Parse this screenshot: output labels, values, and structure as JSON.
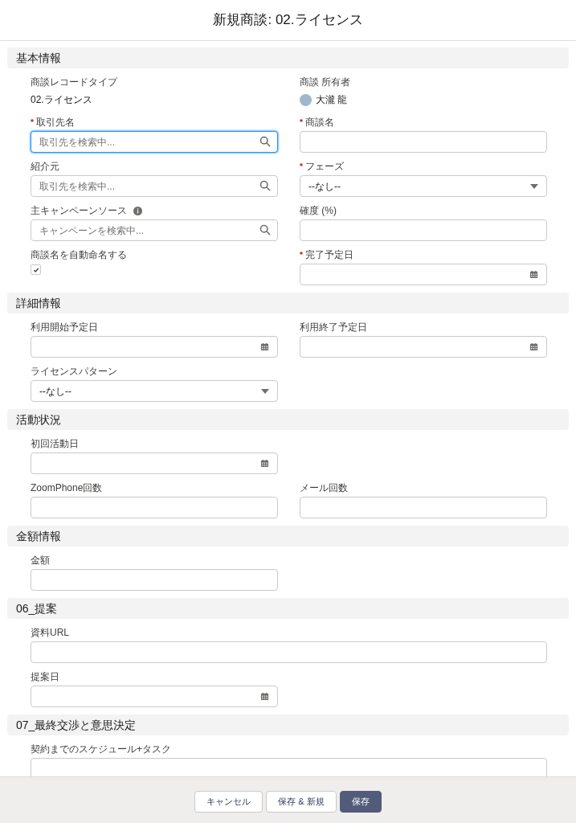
{
  "modal": {
    "title": "新規商談: 02.ライセンス"
  },
  "sections": [
    {
      "title": "基本情報",
      "rows": [
        [
          {
            "kind": "static",
            "label": "商談レコードタイプ",
            "value": "02.ライセンス",
            "required": false
          },
          {
            "kind": "owner",
            "label": "商談 所有者",
            "value": "大瀧 龍",
            "required": false
          }
        ],
        [
          {
            "kind": "lookup",
            "label": "取引先名",
            "placeholder": "取引先を検索中...",
            "required": true,
            "focused": true
          },
          {
            "kind": "text",
            "label": "商談名",
            "required": true
          }
        ],
        [
          {
            "kind": "lookup",
            "label": "紹介元",
            "placeholder": "取引先を検索中...",
            "required": false,
            "focused": false
          },
          {
            "kind": "picklist",
            "label": "フェーズ",
            "value": "--なし--",
            "required": true
          }
        ],
        [
          {
            "kind": "lookup",
            "label": "主キャンペーンソース",
            "placeholder": "キャンペーンを検索中...",
            "required": false,
            "focused": false,
            "info": true
          },
          {
            "kind": "text",
            "label": "確度 (%)",
            "required": false
          }
        ],
        [
          {
            "kind": "checkbox",
            "label": "商談名を自動命名する",
            "checked": true,
            "required": false
          },
          {
            "kind": "date",
            "label": "完了予定日",
            "required": true
          }
        ]
      ]
    },
    {
      "title": "詳細情報",
      "rows": [
        [
          {
            "kind": "date",
            "label": "利用開始予定日",
            "required": false
          },
          {
            "kind": "date",
            "label": "利用終了予定日",
            "required": false
          }
        ],
        [
          {
            "kind": "picklist",
            "label": "ライセンスパターン",
            "value": "--なし--",
            "required": false
          }
        ]
      ]
    },
    {
      "title": "活動状況",
      "rows": [
        [
          {
            "kind": "date",
            "label": "初回活動日",
            "required": false
          }
        ],
        [
          {
            "kind": "text",
            "label": "ZoomPhone回数",
            "required": false
          },
          {
            "kind": "text",
            "label": "メール回数",
            "required": false
          }
        ]
      ]
    },
    {
      "title": "金額情報",
      "rows": [
        [
          {
            "kind": "text",
            "label": "金額",
            "required": false
          }
        ]
      ]
    },
    {
      "title": "06_提案",
      "rows": [
        [
          {
            "kind": "wide",
            "label": "資料URL",
            "required": false
          }
        ],
        [
          {
            "kind": "date",
            "label": "提案日",
            "required": false
          }
        ]
      ]
    },
    {
      "title": "07_最終交渉と意思決定",
      "rows": [
        [
          {
            "kind": "wide",
            "label": "契約までのスケジュール+タスク",
            "required": false
          }
        ]
      ]
    }
  ],
  "footer": {
    "buttons": [
      {
        "label": "キャンセル",
        "kind": "neutral"
      },
      {
        "label": "保存 & 新規",
        "kind": "neutral"
      },
      {
        "label": "保存",
        "kind": "brand"
      }
    ]
  }
}
